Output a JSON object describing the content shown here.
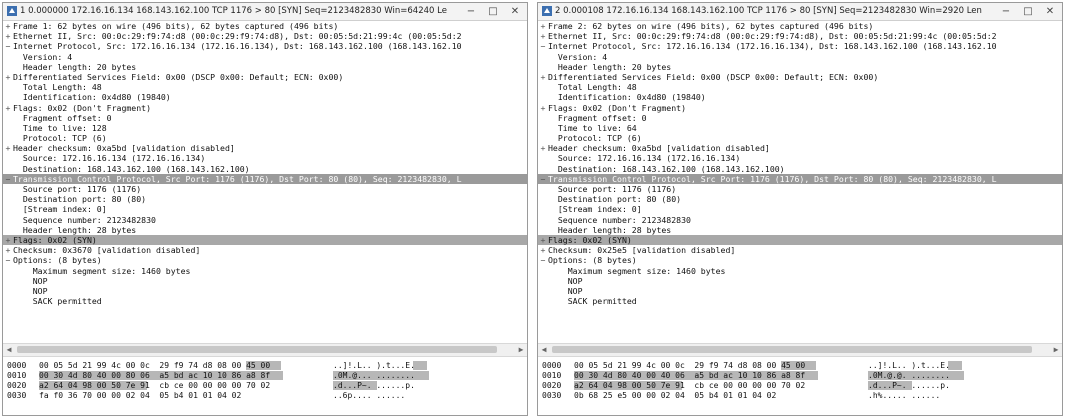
{
  "windows": [
    {
      "title": "1 0.000000 172.16.16.134 168.143.162.100 TCP 1176 > 80 [SYN] Seq=2123482830 Win=64240 Len=0 MSS=1460",
      "controls": [
        "−",
        "□",
        "✕"
      ],
      "tree": [
        {
          "exp": "+",
          "text": "Frame 1: 62 bytes on wire (496 bits), 62 bytes captured (496 bits)"
        },
        {
          "exp": "+",
          "text": "Ethernet II, Src: 00:0c:29:f9:74:d8 (00:0c:29:f9:74:d8), Dst: 00:05:5d:21:99:4c (00:05:5d:2"
        },
        {
          "exp": "−",
          "text": "Internet Protocol, Src: 172.16.16.134 (172.16.16.134), Dst: 168.143.162.100 (168.143.162.10"
        },
        {
          "exp": "",
          "text": "  Version: 4"
        },
        {
          "exp": "",
          "text": "  Header length: 20 bytes"
        },
        {
          "exp": "+",
          "text": "Differentiated Services Field: 0x00 (DSCP 0x00: Default; ECN: 0x00)"
        },
        {
          "exp": "",
          "text": "  Total Length: 48"
        },
        {
          "exp": "",
          "text": "  Identification: 0x4d80 (19840)"
        },
        {
          "exp": "+",
          "text": "Flags: 0x02 (Don't Fragment)"
        },
        {
          "exp": "",
          "text": "  Fragment offset: 0"
        },
        {
          "exp": "",
          "text": "  Time to live: 128"
        },
        {
          "exp": "",
          "text": "  Protocol: TCP (6)"
        },
        {
          "exp": "+",
          "text": "Header checksum: 0xa5bd [validation disabled]"
        },
        {
          "exp": "",
          "text": "  Source: 172.16.16.134 (172.16.16.134)"
        },
        {
          "exp": "",
          "text": "  Destination: 168.143.162.100 (168.143.162.100)"
        },
        {
          "exp": "−",
          "text": "Transmission Control Protocol, Src Port: 1176 (1176), Dst Port: 80 (80), Seq: 2123482830, L",
          "cls": "sel"
        },
        {
          "exp": "",
          "text": "  Source port: 1176 (1176)"
        },
        {
          "exp": "",
          "text": "  Destination port: 80 (80)"
        },
        {
          "exp": "",
          "text": "  [Stream index: 0]"
        },
        {
          "exp": "",
          "text": "  Sequence number: 2123482830"
        },
        {
          "exp": "",
          "text": "  Header length: 28 bytes"
        },
        {
          "exp": "+",
          "text": "Flags: 0x02 (SYN)",
          "cls": "hl"
        },
        {
          "exp": "+",
          "text": "Checksum: 0x3670 [validation disabled]"
        },
        {
          "exp": "−",
          "text": "Options: (8 bytes)"
        },
        {
          "exp": "",
          "text": "    Maximum segment size: 1460 bytes"
        },
        {
          "exp": "",
          "text": "    NOP"
        },
        {
          "exp": "",
          "text": "    NOP"
        },
        {
          "exp": "",
          "text": "    SACK permitted"
        }
      ],
      "hex": [
        {
          "off": "0000",
          "bytes": "00 05 5d 21 99 4c 00 0c  29 f9 74 d8 08 00 45 00",
          "ascii": "..]!.L.. ).t...E."
        },
        {
          "off": "0010",
          "bytes": "00 30 4d 80 40 00 80 06  a5 bd ac 10 10 86 a8 8f",
          "ascii": ".0M.@... ........"
        },
        {
          "off": "0020",
          "bytes": "a2 64 04 98 00 50 7e 91  cb ce 00 00 00 00 70 02",
          "ascii": ".d...P~. ......p."
        },
        {
          "off": "0030",
          "bytes": "fa f0 36 70 00 00 02 04  05 b4 01 01 04 02",
          "ascii": "..6p.... ......"
        }
      ]
    },
    {
      "title": "2 0.000108 172.16.16.134 168.143.162.100 TCP 1176 > 80 [SYN] Seq=2123482830 Win=2920 Len=0 MSS=1460",
      "controls": [
        "−",
        "□",
        "✕"
      ],
      "tree": [
        {
          "exp": "+",
          "text": "Frame 2: 62 bytes on wire (496 bits), 62 bytes captured (496 bits)"
        },
        {
          "exp": "+",
          "text": "Ethernet II, Src: 00:0c:29:f9:74:d8 (00:0c:29:f9:74:d8), Dst: 00:05:5d:21:99:4c (00:05:5d:2"
        },
        {
          "exp": "−",
          "text": "Internet Protocol, Src: 172.16.16.134 (172.16.16.134), Dst: 168.143.162.100 (168.143.162.10"
        },
        {
          "exp": "",
          "text": "  Version: 4"
        },
        {
          "exp": "",
          "text": "  Header length: 20 bytes"
        },
        {
          "exp": "+",
          "text": "Differentiated Services Field: 0x00 (DSCP 0x00: Default; ECN: 0x00)"
        },
        {
          "exp": "",
          "text": "  Total Length: 48"
        },
        {
          "exp": "",
          "text": "  Identification: 0x4d80 (19840)"
        },
        {
          "exp": "+",
          "text": "Flags: 0x02 (Don't Fragment)"
        },
        {
          "exp": "",
          "text": "  Fragment offset: 0"
        },
        {
          "exp": "",
          "text": "  Time to live: 64"
        },
        {
          "exp": "",
          "text": "  Protocol: TCP (6)"
        },
        {
          "exp": "+",
          "text": "Header checksum: 0xa5bd [validation disabled]"
        },
        {
          "exp": "",
          "text": "  Source: 172.16.16.134 (172.16.16.134)"
        },
        {
          "exp": "",
          "text": "  Destination: 168.143.162.100 (168.143.162.100)"
        },
        {
          "exp": "−",
          "text": "Transmission Control Protocol, Src Port: 1176 (1176), Dst Port: 80 (80), Seq: 2123482830, L",
          "cls": "sel"
        },
        {
          "exp": "",
          "text": "  Source port: 1176 (1176)"
        },
        {
          "exp": "",
          "text": "  Destination port: 80 (80)"
        },
        {
          "exp": "",
          "text": "  [Stream index: 0]"
        },
        {
          "exp": "",
          "text": "  Sequence number: 2123482830"
        },
        {
          "exp": "",
          "text": "  Header length: 28 bytes"
        },
        {
          "exp": "+",
          "text": "Flags: 0x02 (SYN)",
          "cls": "hl"
        },
        {
          "exp": "+",
          "text": "Checksum: 0x25e5 [validation disabled]"
        },
        {
          "exp": "−",
          "text": "Options: (8 bytes)"
        },
        {
          "exp": "",
          "text": "    Maximum segment size: 1460 bytes"
        },
        {
          "exp": "",
          "text": "    NOP"
        },
        {
          "exp": "",
          "text": "    NOP"
        },
        {
          "exp": "",
          "text": "    SACK permitted"
        }
      ],
      "hex": [
        {
          "off": "0000",
          "bytes": "00 05 5d 21 99 4c 00 0c  29 f9 74 d8 08 00 45 00",
          "ascii": "..]!.L.. ).t...E."
        },
        {
          "off": "0010",
          "bytes": "00 30 4d 80 40 00 40 06  a5 bd ac 10 10 86 a8 8f",
          "ascii": ".0M.@.@. ........"
        },
        {
          "off": "0020",
          "bytes": "a2 64 04 98 00 50 7e 91  cb ce 00 00 00 00 70 02",
          "ascii": ".d...P~. ......p."
        },
        {
          "off": "0030",
          "bytes": "0b 68 25 e5 00 00 02 04  05 b4 01 01 04 02",
          "ascii": ".h%..... ......"
        }
      ]
    }
  ],
  "colors": {
    "selection": "#9a9a9a",
    "highlight": "#a8a8a8",
    "hexmark": "#7c7c7c"
  },
  "icons": {
    "app": "wireshark-fin-icon",
    "expand": "plus-box-icon",
    "collapse": "minus-box-icon"
  }
}
